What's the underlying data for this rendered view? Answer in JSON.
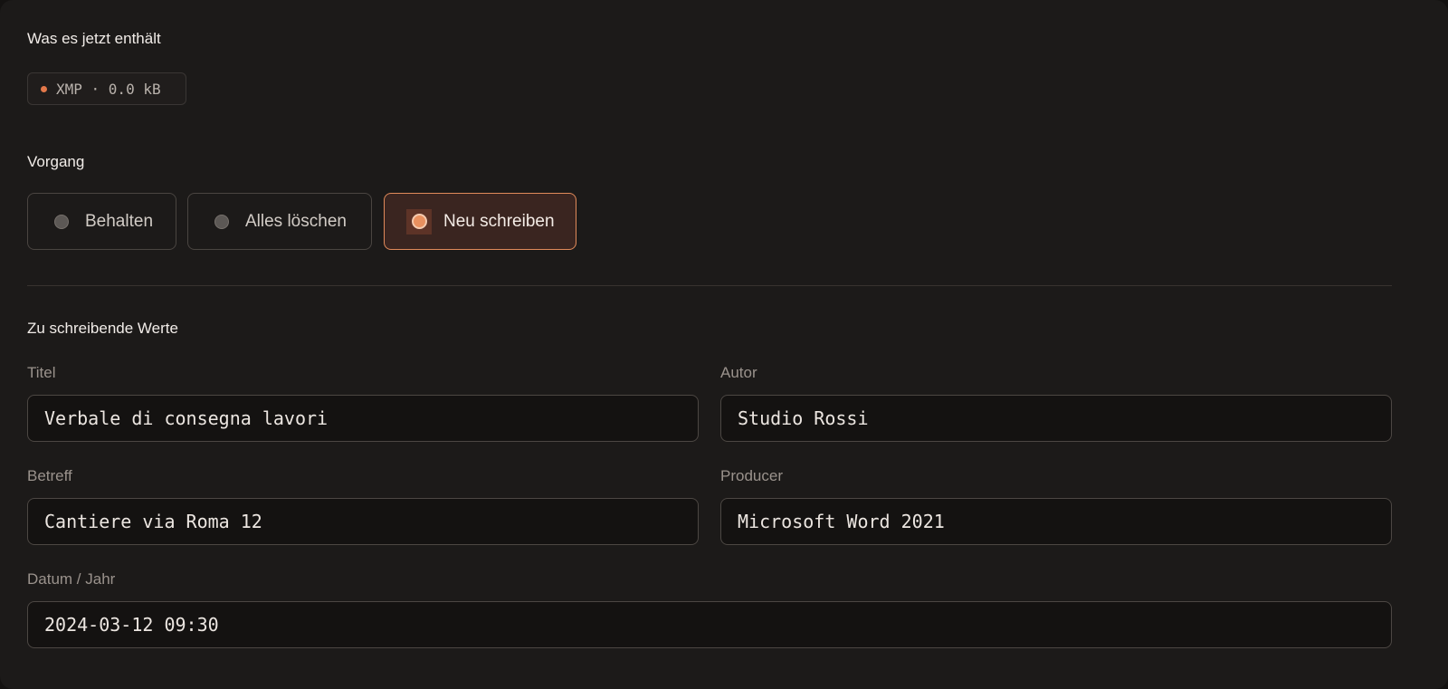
{
  "contains": {
    "heading": "Was es jetzt enthält",
    "chip_text": "XMP · 0.0 kB",
    "chip_dot_color": "#e3784a"
  },
  "operation": {
    "heading": "Vorgang",
    "options": [
      {
        "label": "Behalten",
        "selected": false
      },
      {
        "label": "Alles löschen",
        "selected": false
      },
      {
        "label": "Neu schreiben",
        "selected": true
      }
    ],
    "accent_color": "#e08a5a"
  },
  "values": {
    "heading": "Zu schreibende Werte",
    "fields": {
      "title": {
        "label": "Titel",
        "value": "Verbale di consegna lavori"
      },
      "author": {
        "label": "Autor",
        "value": "Studio Rossi"
      },
      "subject": {
        "label": "Betreff",
        "value": "Cantiere via Roma 12"
      },
      "producer": {
        "label": "Producer",
        "value": "Microsoft Word 2021"
      },
      "date": {
        "label": "Datum / Jahr",
        "value": "2024-03-12 09:30"
      }
    }
  }
}
